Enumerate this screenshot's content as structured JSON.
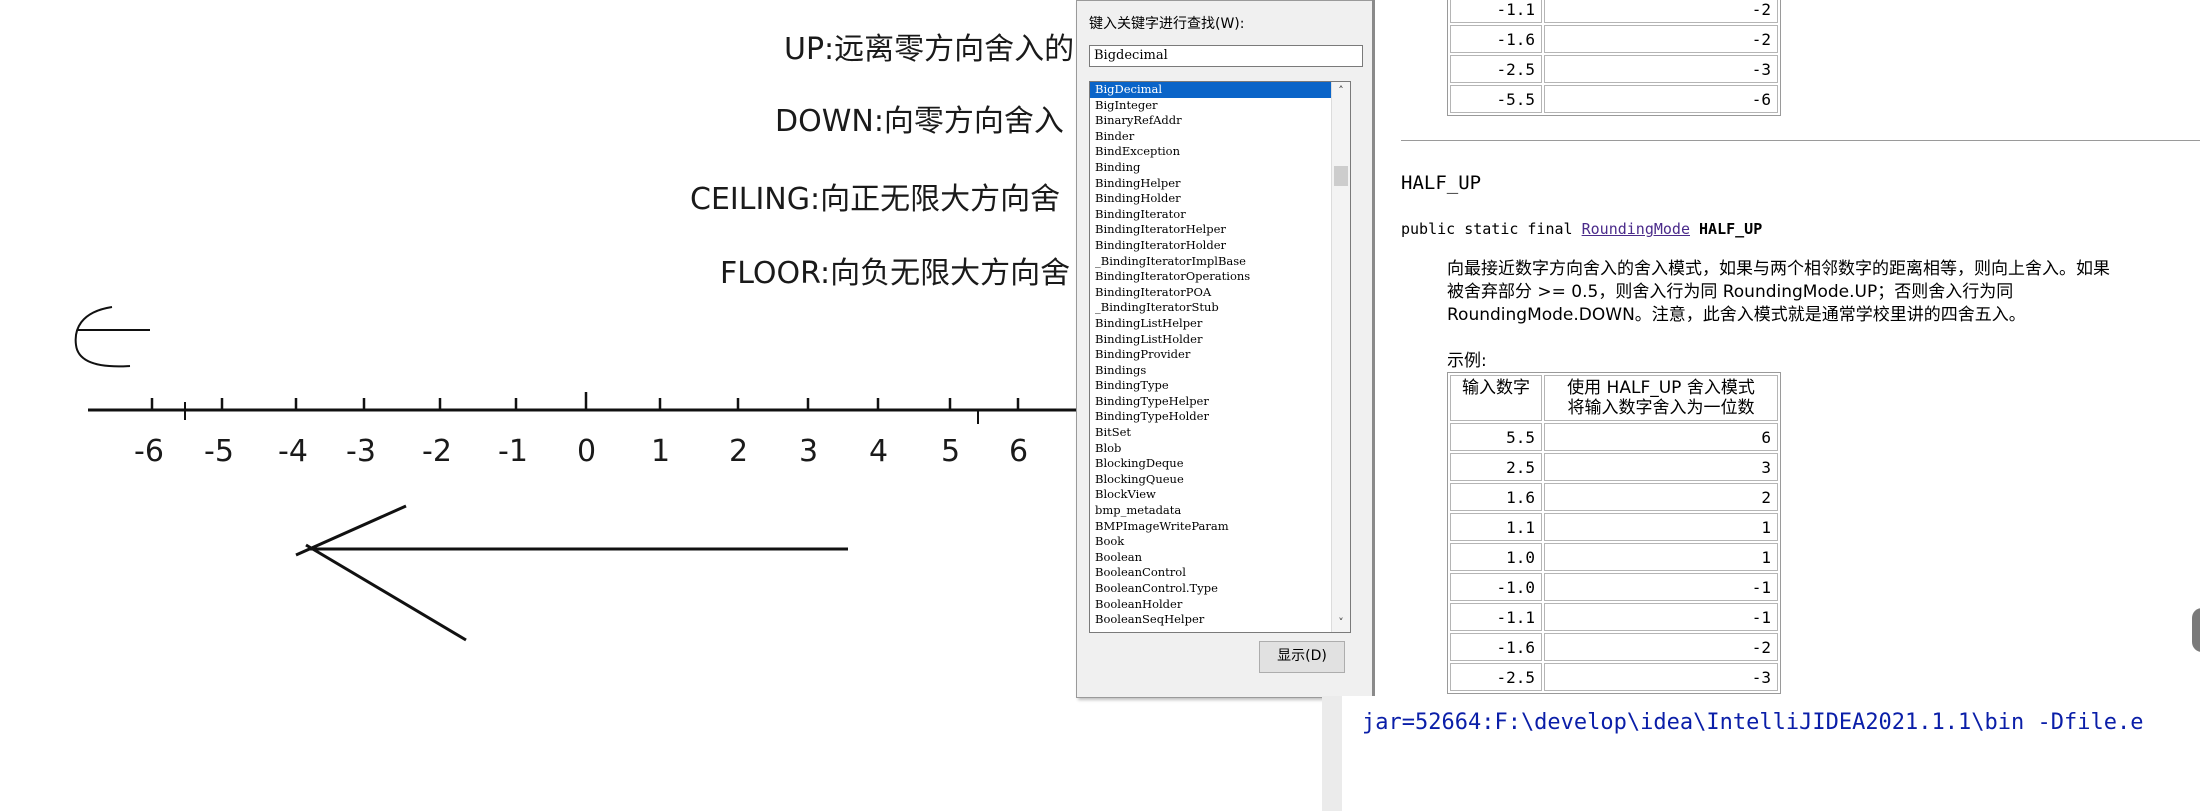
{
  "rules": [
    "UP:远离零方向舍入的",
    "DOWN:向零方向舍入",
    "CEILING:向正无限大方向舍",
    "FLOOR:向负无限大方向舍"
  ],
  "number_line": {
    "labels": [
      "-6",
      "-5",
      "-4",
      "-3",
      "-2",
      "-1",
      "0",
      "1",
      "2",
      "3",
      "4",
      "5",
      "6"
    ]
  },
  "help_dialog": {
    "search_label": "键入关键字进行查找(W):",
    "search_value": "Bigdecimal",
    "show_button": "显示(D)",
    "index_items": [
      "BigDecimal",
      "BigInteger",
      "BinaryRefAddr",
      "Binder",
      "BindException",
      "Binding",
      "BindingHelper",
      "BindingHolder",
      "BindingIterator",
      "BindingIteratorHelper",
      "BindingIteratorHolder",
      "_BindingIteratorImplBase",
      "BindingIteratorOperations",
      "BindingIteratorPOA",
      "_BindingIteratorStub",
      "BindingListHelper",
      "BindingListHolder",
      "BindingProvider",
      "Bindings",
      "BindingType",
      "BindingTypeHelper",
      "BindingTypeHolder",
      "BitSet",
      "Blob",
      "BlockingDeque",
      "BlockingQueue",
      "BlockView",
      "bmp_metadata",
      "BMPImageWriteParam",
      "Book",
      "Boolean",
      "BooleanControl",
      "BooleanControl.Type",
      "BooleanHolder",
      "BooleanSeqHelper"
    ],
    "selected_index": 0
  },
  "doc": {
    "top_table_rows": [
      {
        "input": "-1.1",
        "output": "-2"
      },
      {
        "input": "-1.6",
        "output": "-2"
      },
      {
        "input": "-2.5",
        "output": "-3"
      },
      {
        "input": "-5.5",
        "output": "-6"
      }
    ],
    "heading": "HALF_UP",
    "signature_prefix": "public static final ",
    "signature_type": "RoundingMode",
    "signature_name": "HALF_UP",
    "description_line1": "向最接近数字方向舍入的舍入模式，如果与两个相邻数字的距离相等，则向上舍入。如果",
    "description_line2": "被舍弃部分 >= 0.5，则舍入行为同 RoundingMode.UP；否则舍入行为同",
    "description_line3": "RoundingMode.DOWN。注意，此舍入模式就是通常学校里讲的四舍五入。",
    "example_label": "示例:",
    "table_header_input": "输入数字",
    "table_header_output_line1": "使用 HALF_UP 舍入模式",
    "table_header_output_line2": "将输入数字舍入为一位数",
    "table_rows": [
      {
        "input": "5.5",
        "output": "6"
      },
      {
        "input": "2.5",
        "output": "3"
      },
      {
        "input": "1.6",
        "output": "2"
      },
      {
        "input": "1.1",
        "output": "1"
      },
      {
        "input": "1.0",
        "output": "1"
      },
      {
        "input": "-1.0",
        "output": "-1"
      },
      {
        "input": "-1.1",
        "output": "-1"
      },
      {
        "input": "-1.6",
        "output": "-2"
      },
      {
        "input": "-2.5",
        "output": "-3"
      }
    ]
  },
  "console": {
    "text": "jar=52664:F:\\develop\\idea\\IntelliJIDEA2021.1.1\\bin -Dfile.e"
  }
}
